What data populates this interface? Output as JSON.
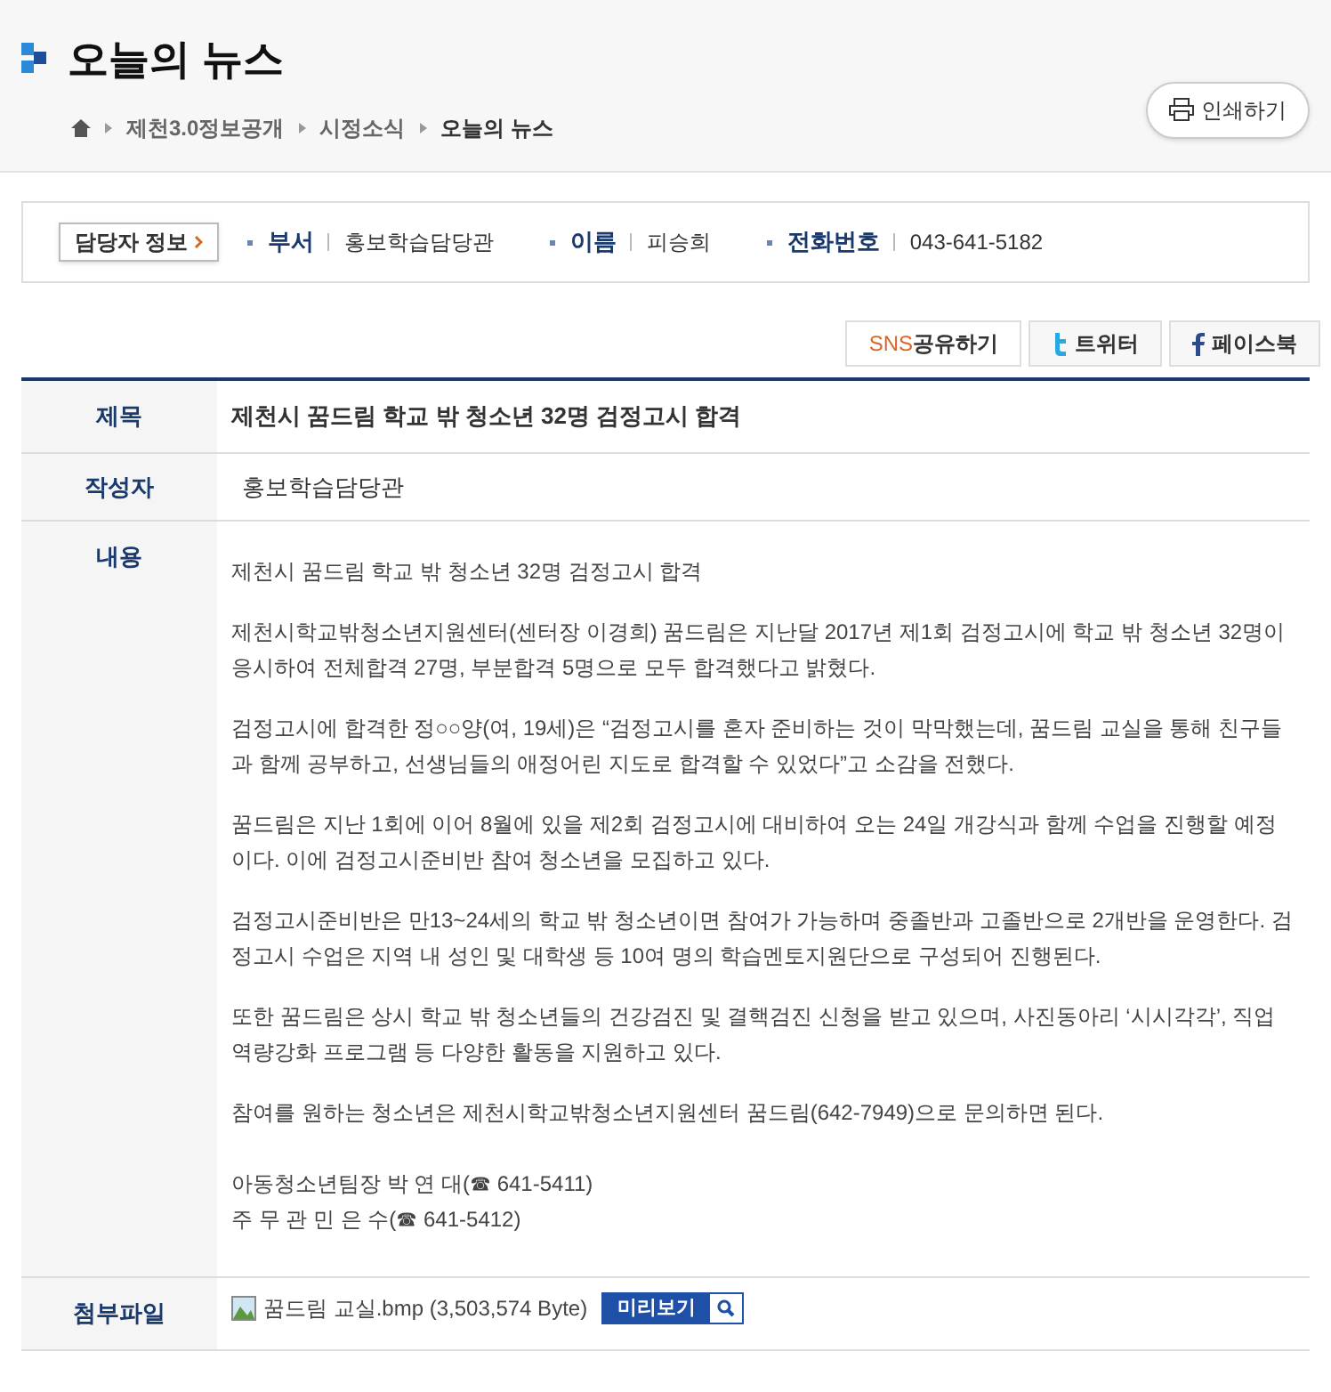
{
  "page_title": "오늘의 뉴스",
  "breadcrumb": [
    "제천3.0정보공개",
    "시정소식",
    "오늘의 뉴스"
  ],
  "print_button": "인쇄하기",
  "contact": {
    "button": "담당자 정보",
    "fields": [
      {
        "label": "부서",
        "value": "홍보학습담당관"
      },
      {
        "label": "이름",
        "value": "피승희"
      },
      {
        "label": "전화번호",
        "value": "043-641-5182"
      }
    ]
  },
  "share": {
    "label_prefix": "SNS",
    "label_rest": "공유하기",
    "buttons": [
      {
        "kind": "twitter",
        "label": "트위터"
      },
      {
        "kind": "facebook",
        "label": "페이스북"
      }
    ]
  },
  "article": {
    "title_label": "제목",
    "title": "제천시 꿈드림 학교 밖 청소년 32명 검정고시 합격",
    "author_label": "작성자",
    "author": "홍보학습담당관",
    "content_label": "내용",
    "paragraphs": [
      "제천시 꿈드림 학교 밖 청소년 32명 검정고시 합격",
      "제천시학교밖청소년지원센터(센터장 이경희) 꿈드림은 지난달 2017년 제1회 검정고시에 학교 밖 청소년 32명이 응시하여 전체합격 27명, 부분합격 5명으로 모두 합격했다고 밝혔다.",
      "검정고시에 합격한 정○○양(여, 19세)은 “검정고시를 혼자 준비하는 것이 막막했는데, 꿈드림 교실을 통해 친구들과 함께 공부하고, 선생님들의 애정어린 지도로 합격할 수 있었다”고 소감을 전했다.",
      "꿈드림은 지난 1회에 이어 8월에 있을 제2회 검정고시에 대비하여 오는 24일 개강식과 함께 수업을 진행할 예정이다. 이에 검정고시준비반 참여 청소년을 모집하고 있다.",
      "검정고시준비반은 만13~24세의 학교 밖 청소년이면 참여가 가능하며 중졸반과 고졸반으로 2개반을 운영한다. 검정고시 수업은 지역 내 성인 및 대학생 등 10여 명의 학습멘토지원단으로 구성되어 진행된다.",
      "또한 꿈드림은 상시 학교 밖 청소년들의 건강검진 및 결핵검진 신청을 받고 있으며, 사진동아리 ‘시시각각’, 직업역량강화 프로그램 등 다양한 활동을 지원하고 있다.",
      "참여를 원하는 청소년은 제천시학교밖청소년지원센터 꿈드림(642-7949)으로 문의하면 된다."
    ],
    "contacts": [
      "아동청소년팀장 박 연 대(☎ 641-5411)",
      "주 무 관 민 은 수(☎ 641-5412)"
    ],
    "attachment_label": "첨부파일",
    "attachment": "꿈드림 교실.bmp (3,503,574 Byte)",
    "preview_button": "미리보기"
  }
}
